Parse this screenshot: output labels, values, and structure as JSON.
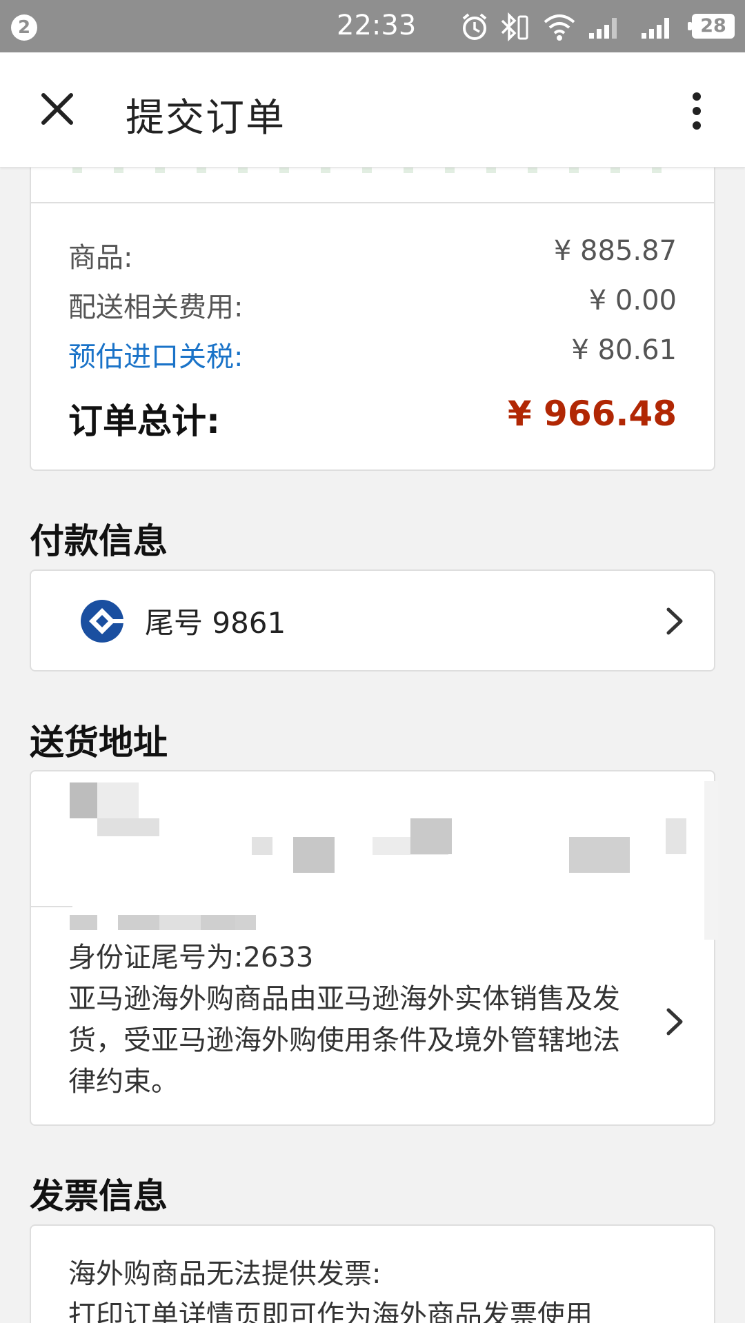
{
  "status_bar": {
    "notification_count": "2",
    "time": "22:33",
    "battery": "28"
  },
  "app_bar": {
    "title": "提交订单"
  },
  "order_summary": {
    "items_label": "商品:",
    "items_value": "¥ 885.87",
    "shipping_label": "配送相关费用:",
    "shipping_value": "¥ 0.00",
    "duty_label": "预估进口关税:",
    "duty_value": "¥ 80.61",
    "total_label": "订单总计:",
    "total_value": "¥ 966.48"
  },
  "payment": {
    "heading": "付款信息",
    "card_text": "尾号 9861"
  },
  "shipping": {
    "heading": "送货地址",
    "id_text": "身份证尾号为:2633",
    "notice": "亚马逊海外购商品由亚马逊海外实体销售及发货，受亚马逊海外购使用条件及境外管辖地法律约束。"
  },
  "invoice": {
    "heading": "发票信息",
    "line1": "海外购商品无法提供发票:",
    "line2": "打印订单详情页即可作为海外商品发票使用"
  },
  "colors": {
    "status_bar": "#8f8f8f",
    "link": "#1a73c8",
    "total": "#b12704",
    "bank_logo": "#1a4fa0"
  }
}
